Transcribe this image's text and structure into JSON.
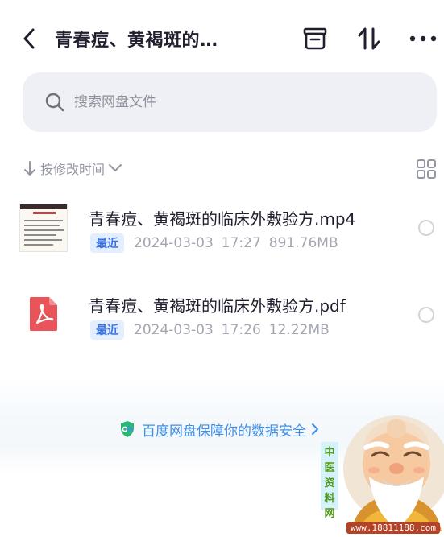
{
  "header": {
    "title": "青春痘、黄褐斑的…"
  },
  "search": {
    "placeholder": "搜索网盘文件"
  },
  "sort": {
    "label": "按修改时间"
  },
  "files": [
    {
      "name": "青春痘、黄褐斑的临床外敷验方.mp4",
      "badge": "最近",
      "date": "2024-03-03",
      "time": "17:27",
      "size": "891.76MB",
      "icon": "video-thumbnail"
    },
    {
      "name": "青春痘、黄褐斑的临床外敷验方.pdf",
      "badge": "最近",
      "date": "2024-03-03",
      "time": "17:26",
      "size": "12.22MB",
      "icon": "pdf-icon"
    }
  ],
  "footer": {
    "security_text": "百度网盘保障你的数据安全"
  },
  "watermark": {
    "vertical_chars": [
      "中",
      "医",
      "资",
      "料",
      "网"
    ],
    "url": "www.18811188.com"
  },
  "colors": {
    "accent": "#3a72e0",
    "search_bg": "#eef0f6",
    "pdf_red": "#e8545a",
    "security_blue": "#3d8fe8"
  }
}
